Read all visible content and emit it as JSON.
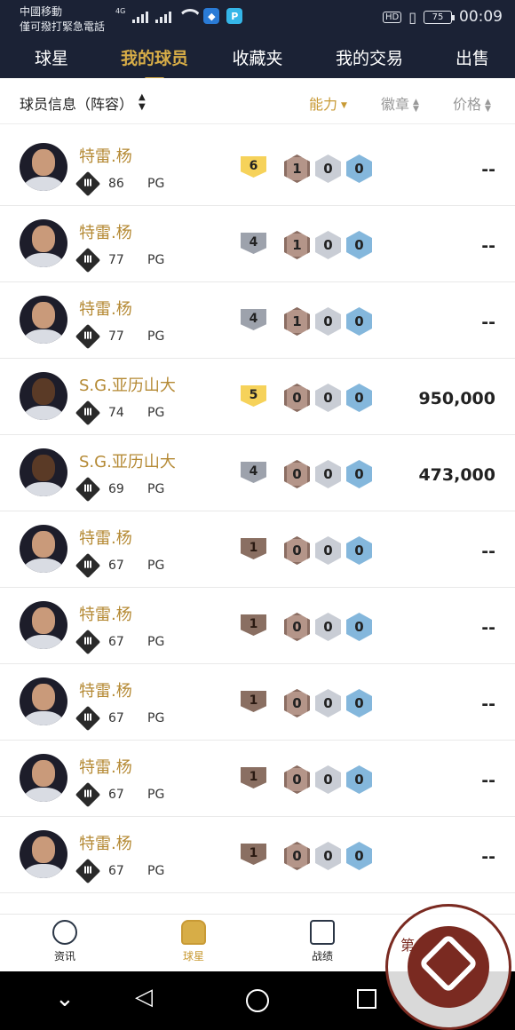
{
  "status": {
    "carrier_line1": "中國移動",
    "carrier_line2": "僅可撥打緊急電話",
    "network": "4G",
    "hd": "HD",
    "battery": "75",
    "time": "00:09"
  },
  "topnav": {
    "tabs": [
      {
        "label": "球星",
        "active": false
      },
      {
        "label": "我的球员",
        "active": true
      },
      {
        "label": "收藏夹",
        "active": false
      },
      {
        "label": "我的交易",
        "active": false
      },
      {
        "label": "出售",
        "active": false
      }
    ]
  },
  "filter": {
    "title": "球员信息（阵容）",
    "sort_ability": "能力",
    "sort_badge": "徽章",
    "sort_price": "价格"
  },
  "colors": {
    "header_bg": "#1b2235",
    "accent_gold": "#d7ad47",
    "level_gold": "#f6d25a",
    "level_silver": "#9da2ac",
    "level_bronze": "#8a6f62"
  },
  "players": [
    {
      "name": "特雷.杨",
      "ovr": "86",
      "pos": "PG",
      "level": "6",
      "level_tier": "gold",
      "badge_bronze": "1",
      "badge_silver": "0",
      "badge_gold": "0",
      "price": "--",
      "skin": "#c99a7a"
    },
    {
      "name": "特雷.杨",
      "ovr": "77",
      "pos": "PG",
      "level": "4",
      "level_tier": "silver",
      "badge_bronze": "1",
      "badge_silver": "0",
      "badge_gold": "0",
      "price": "--",
      "skin": "#c99a7a"
    },
    {
      "name": "特雷.杨",
      "ovr": "77",
      "pos": "PG",
      "level": "4",
      "level_tier": "silver",
      "badge_bronze": "1",
      "badge_silver": "0",
      "badge_gold": "0",
      "price": "--",
      "skin": "#c99a7a"
    },
    {
      "name": "S.G.亚历山大",
      "ovr": "74",
      "pos": "PG",
      "level": "5",
      "level_tier": "gold",
      "badge_bronze": "0",
      "badge_silver": "0",
      "badge_gold": "0",
      "price": "950,000",
      "skin": "#5a3a26"
    },
    {
      "name": "S.G.亚历山大",
      "ovr": "69",
      "pos": "PG",
      "level": "4",
      "level_tier": "silver",
      "badge_bronze": "0",
      "badge_silver": "0",
      "badge_gold": "0",
      "price": "473,000",
      "skin": "#5a3a26"
    },
    {
      "name": "特雷.杨",
      "ovr": "67",
      "pos": "PG",
      "level": "1",
      "level_tier": "bronze",
      "badge_bronze": "0",
      "badge_silver": "0",
      "badge_gold": "0",
      "price": "--",
      "skin": "#c99a7a"
    },
    {
      "name": "特雷.杨",
      "ovr": "67",
      "pos": "PG",
      "level": "1",
      "level_tier": "bronze",
      "badge_bronze": "0",
      "badge_silver": "0",
      "badge_gold": "0",
      "price": "--",
      "skin": "#c99a7a"
    },
    {
      "name": "特雷.杨",
      "ovr": "67",
      "pos": "PG",
      "level": "1",
      "level_tier": "bronze",
      "badge_bronze": "0",
      "badge_silver": "0",
      "badge_gold": "0",
      "price": "--",
      "skin": "#c99a7a"
    },
    {
      "name": "特雷.杨",
      "ovr": "67",
      "pos": "PG",
      "level": "1",
      "level_tier": "bronze",
      "badge_bronze": "0",
      "badge_silver": "0",
      "badge_gold": "0",
      "price": "--",
      "skin": "#c99a7a"
    },
    {
      "name": "特雷.杨",
      "ovr": "67",
      "pos": "PG",
      "level": "1",
      "level_tier": "bronze",
      "badge_bronze": "0",
      "badge_silver": "0",
      "badge_gold": "0",
      "price": "--",
      "skin": "#c99a7a"
    }
  ],
  "bottomnav": {
    "items": [
      {
        "label": "资讯",
        "icon": "basketball-icon",
        "active": false
      },
      {
        "label": "球星",
        "icon": "jersey-icon",
        "active": true
      },
      {
        "label": "战绩",
        "icon": "hoop-icon",
        "active": false
      }
    ]
  },
  "watermark": {
    "text": "第一私募"
  }
}
